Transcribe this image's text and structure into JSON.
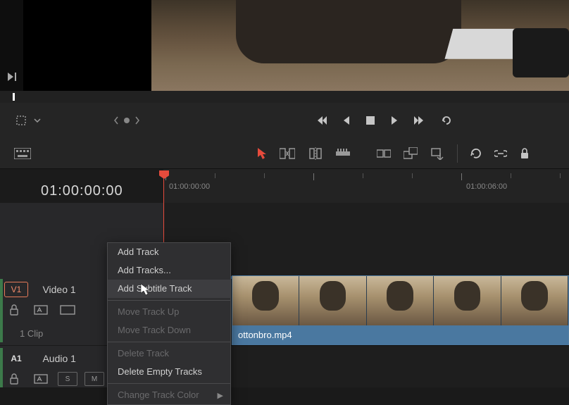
{
  "timecode": "01:00:00:00",
  "ruler": {
    "labels": [
      {
        "pos": 8,
        "text": "01:00:00:00"
      },
      {
        "pos": 430,
        "text": "01:00:06:00"
      }
    ]
  },
  "tracks": {
    "video": {
      "btn": "V1",
      "name": "Video 1",
      "clip_count": "1 Clip"
    },
    "audio": {
      "btn": "A1",
      "name": "Audio 1",
      "toggles": {
        "solo": "S",
        "mute": "M"
      }
    }
  },
  "clip": {
    "filename": "ottonbro.mp4"
  },
  "context_menu": {
    "items": [
      {
        "label": "Add Track",
        "disabled": false,
        "sep_after": false
      },
      {
        "label": "Add Tracks...",
        "disabled": false,
        "sep_after": false
      },
      {
        "label": "Add Subtitle Track",
        "disabled": false,
        "hover": true,
        "sep_after": true
      },
      {
        "label": "Move Track Up",
        "disabled": true,
        "sep_after": false
      },
      {
        "label": "Move Track Down",
        "disabled": true,
        "sep_after": true
      },
      {
        "label": "Delete Track",
        "disabled": true,
        "sep_after": false
      },
      {
        "label": "Delete Empty Tracks",
        "disabled": false,
        "sep_after": true
      },
      {
        "label": "Change Track Color",
        "disabled": true,
        "submenu": true,
        "sep_after": false
      }
    ]
  }
}
